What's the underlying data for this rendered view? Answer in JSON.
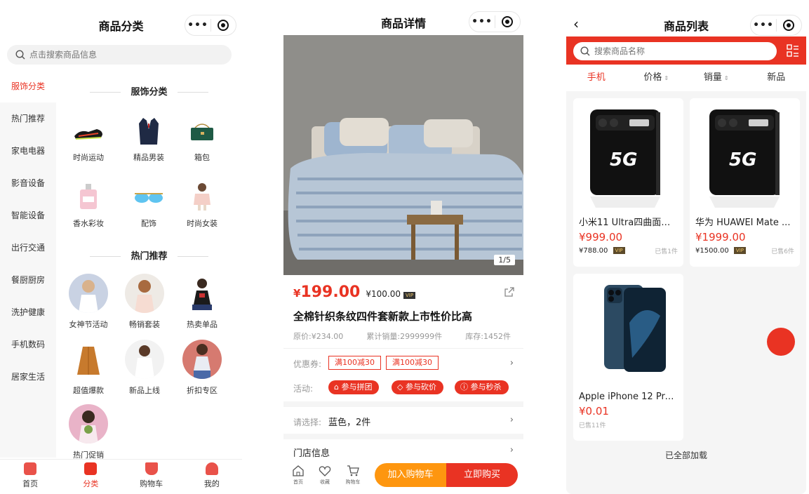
{
  "category": {
    "title": "商品分类",
    "search_placeholder": "点击搜索商品信息",
    "sidebar": [
      "服饰分类",
      "热门推荐",
      "家电电器",
      "影音设备",
      "智能设备",
      "出行交通",
      "餐厨厨房",
      "洗护健康",
      "手机数码",
      "居家生活"
    ],
    "sections": [
      {
        "title": "服饰分类",
        "items": [
          "时尚运动",
          "精品男装",
          "箱包",
          "香水彩妆",
          "配饰",
          "时尚女装"
        ]
      },
      {
        "title": "热门推荐",
        "items": [
          "女神节活动",
          "畅销套装",
          "热卖单品",
          "超值爆款",
          "新品上线",
          "折扣专区",
          "热门促销"
        ]
      }
    ],
    "tabbar": [
      "首页",
      "分类",
      "购物车",
      "我的"
    ]
  },
  "detail": {
    "title": "商品详情",
    "pager": "1/5",
    "price_symbol": "¥",
    "price": "199.00",
    "vip_price": "¥100.00",
    "vip_tag": "VIP",
    "product_title": "全棉针织条纹四件套新款上市性价比高",
    "original_price": "原价:¥234.00",
    "sales": "累计销量:2999999件",
    "stock": "库存:1452件",
    "coupon_label": "优惠券:",
    "coupons": [
      "满100减30",
      "满100减30"
    ],
    "activity_label": "活动:",
    "activities": [
      "参与拼团",
      "参与砍价",
      "参与秒杀"
    ],
    "select_label": "请选择:",
    "select_value": "蓝色，2件",
    "store_info": "门店信息",
    "bottom_icons": [
      "首页",
      "收藏",
      "购物车"
    ],
    "add_cart": "加入购物车",
    "buy_now": "立即购买"
  },
  "list": {
    "title": "商品列表",
    "search_placeholder": "搜索商品名称",
    "sort_tabs": [
      "手机",
      "价格",
      "销量",
      "新品"
    ],
    "products": [
      {
        "name": "小米11 Ultra四曲面柔...",
        "price": "¥999.00",
        "vip_price": "¥788.00",
        "sold": "已售1件",
        "badge": "5G"
      },
      {
        "name": "华为 HUAWEI Mate ...",
        "price": "¥1999.00",
        "vip_price": "¥1500.00",
        "sold": "已售6件",
        "badge": "5G"
      },
      {
        "name": "Apple iPhone 12 Pro ...",
        "price": "¥0.01",
        "vip_price": "",
        "sold": "已售11件",
        "badge": ""
      }
    ],
    "footer": "已全部加载"
  },
  "colors": {
    "accent": "#e93323",
    "orange": "#fe960f",
    "vip": "#333333"
  },
  "icons": [
    "search-icon",
    "more-icon",
    "target-icon",
    "share-icon",
    "chevron-right-icon",
    "home-icon",
    "heart-icon",
    "cart-icon",
    "back-icon",
    "grid-icon"
  ]
}
